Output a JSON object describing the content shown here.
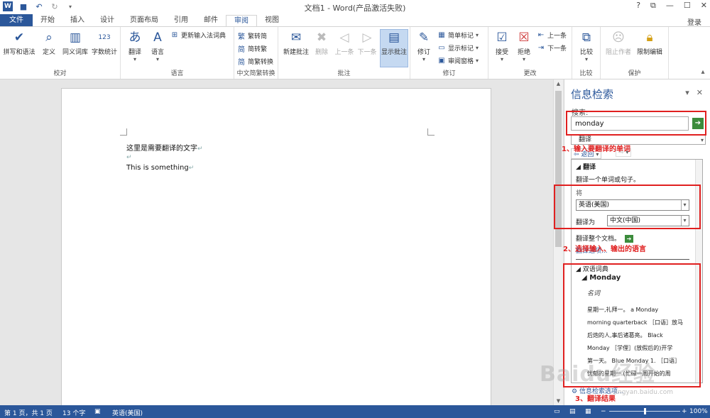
{
  "titlebar": {
    "title": "文档1 - Word(产品激活失败)",
    "help": "?",
    "restore": "⧉",
    "minimize": "—",
    "maximize": "☐",
    "close": "✕",
    "signin": "登录"
  },
  "tabs": [
    "文件",
    "开始",
    "插入",
    "设计",
    "页面布局",
    "引用",
    "邮件",
    "审阅",
    "视图"
  ],
  "ribbon": {
    "proofing": {
      "label": "校对",
      "buttons": [
        "拼写和语法",
        "定义",
        "同义词库",
        "字数统计"
      ]
    },
    "language": {
      "label": "语言",
      "translate": "翻译",
      "language": "语言",
      "update_ime": "更新输入法词典"
    },
    "chinese_conv": {
      "label": "中文简繁转换",
      "to_simplified": "繁转简",
      "to_traditional": "简转繁",
      "conversion": "简繁转换"
    },
    "comments": {
      "label": "批注",
      "new": "新建批注",
      "delete": "删除",
      "prev": "上一条",
      "next": "下一条",
      "show": "显示批注"
    },
    "tracking": {
      "label": "修订",
      "track": "修订",
      "markup_mode": "简单标记",
      "show_markup": "显示标记",
      "review_pane": "审阅窗格"
    },
    "changes": {
      "label": "更改",
      "accept": "接受",
      "reject": "拒绝",
      "prev": "上一条",
      "next": "下一条"
    },
    "compare": {
      "label": "比较",
      "compare": "比较"
    },
    "protect": {
      "label": "保护",
      "block_authors": "阻止作者",
      "restrict": "限制编辑"
    }
  },
  "document": {
    "line1": "这里是需要翻译的文字",
    "line2": "This is something"
  },
  "pane": {
    "title": "信息检索",
    "search_label": "搜索:",
    "search_value": "monday",
    "source": "翻译",
    "back": "返回",
    "section_translate": "翻译",
    "translate_desc": "翻译一个单词或句子。",
    "from_label": "将",
    "from_lang": "英语(美国)",
    "to_label": "翻译为",
    "to_lang": "中文(中国)",
    "translate_doc": "翻译整个文档。",
    "translate_options": "翻译选项...",
    "bilingual_dict": "双语词典",
    "headword": "Monday",
    "pos": "名词",
    "definition": [
      "星期一,礼拜一。 a Monday",
      "morning quarterback ［口语］放马",
      "后炮的人,事后诸葛亮。 Black",
      "Monday ［学俚］(放假后的)开学",
      "第一天。 Blue Monday 1. ［口语］",
      "忧郁的星期一 (忙碌一周开始的周"
    ],
    "footer": "信息检索选项..."
  },
  "annotations": {
    "step1": "1、输入要翻译的单词",
    "step2": "2、选择输入、输出的语言",
    "step3": "3、翻译结果"
  },
  "watermark": {
    "text": "Baidu经验",
    "sub": "jingyan.baidu.com"
  },
  "statusbar": {
    "page": "第 1 页，共 1 页",
    "words": "13 个字",
    "lang": "英语(美国)",
    "zoom": "100%"
  }
}
